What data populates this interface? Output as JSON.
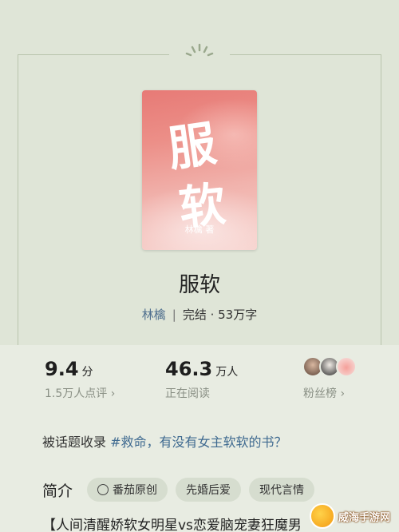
{
  "book": {
    "cover_title_line1": "服",
    "cover_title_line2": "软",
    "cover_author": "林檎 著",
    "title": "服软",
    "author": "林檎",
    "separator": "|",
    "status": "完结 · 53万字"
  },
  "stats": {
    "rating": "9.4",
    "rating_unit": "分",
    "rating_sub": "1.5万人点评 ›",
    "reading": "46.3",
    "reading_unit": "万人",
    "reading_sub": "正在阅读",
    "fans_label": "粉丝榜 ›"
  },
  "topic": {
    "prefix": "被话题收录 ",
    "tag": "#救命，有没有女主软软的书？"
  },
  "intro": {
    "title": "简介",
    "chips": [
      "番茄原创",
      "先婚后爱",
      "现代言情"
    ],
    "first_line": "【人间清醒娇软女明星vs恋爱脑宠妻狂魔男"
  },
  "watermark": {
    "text": "威海手游网"
  },
  "colors": {
    "background": "#dfe5d7",
    "panel": "#e8ece2",
    "link": "#4f6f8e",
    "tag": "#3f6a90",
    "chip": "#d6ddcf"
  }
}
